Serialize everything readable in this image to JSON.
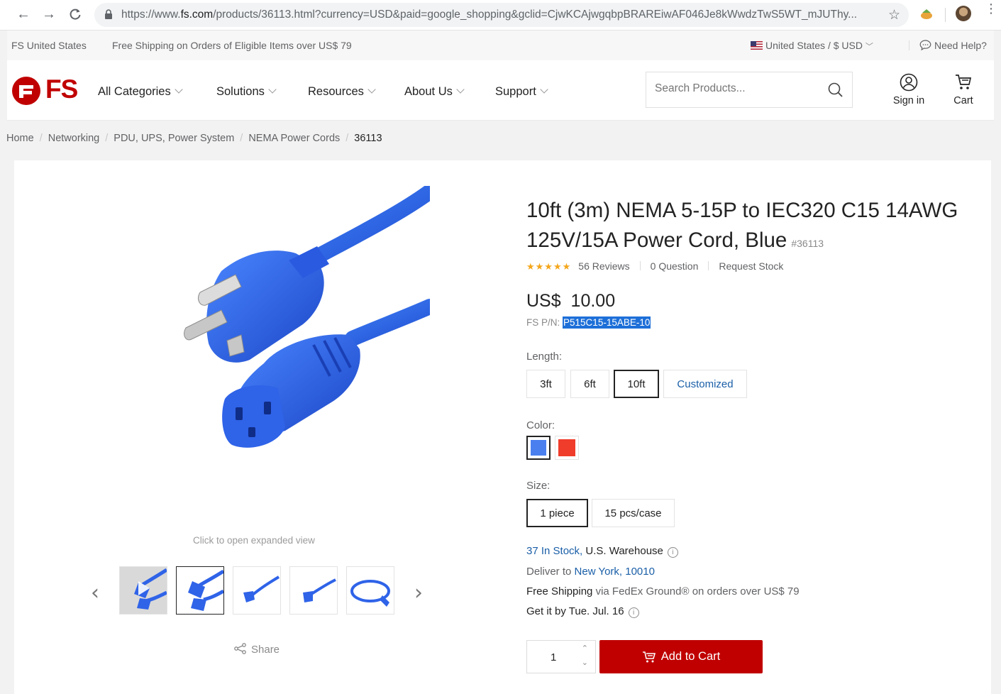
{
  "browser": {
    "url_prefix": "https://www.",
    "url_domain": "fs.com",
    "url_rest": "/products/36113.html?currency=USD&paid=google_shopping&gclid=CjwKCAjwgqbpBRAREiwAF046Je8kWwdzTwS5WT_mJUThy..."
  },
  "topbar": {
    "site_region": "FS United States",
    "shipping_notice": "Free Shipping on Orders of Eligible Items over US$ 79",
    "locale": "United States / $ USD",
    "help": "Need Help?"
  },
  "header": {
    "logo_text": "FS",
    "menu": [
      "All Categories",
      "Solutions",
      "Resources",
      "About Us",
      "Support"
    ],
    "search_placeholder": "Search Products...",
    "sign_in": "Sign in",
    "cart": "Cart"
  },
  "breadcrumb": [
    "Home",
    "Networking",
    "PDU, UPS, Power System",
    "NEMA Power Cords",
    "36113"
  ],
  "gallery": {
    "click_note": "Click to open expanded view",
    "share": "Share"
  },
  "product": {
    "title": "10ft (3m) NEMA 5-15P to IEC320 C15 14AWG 125V/15A Power Cord, Blue",
    "id": "#36113",
    "rating_stars": 5,
    "reviews": "56 Reviews",
    "questions": "0 Question",
    "request_stock": "Request Stock",
    "currency": "US$",
    "price": "10.00",
    "pn_label": "FS P/N:",
    "pn_value": "P515C15-15ABE-10",
    "length_label": "Length:",
    "lengths": [
      "3ft",
      "6ft",
      "10ft",
      "Customized"
    ],
    "color_label": "Color:",
    "colors": [
      "#4a7ff0",
      "#f03c2a"
    ],
    "size_label": "Size:",
    "sizes": [
      "1 piece",
      "15 pcs/case"
    ],
    "stock_count": "37 In Stock,",
    "warehouse": "U.S. Warehouse",
    "deliver_label": "Deliver to",
    "deliver_location": "New York, 10010",
    "free_shipping": "Free Shipping",
    "shipping_detail": "via FedEx Ground® on orders over US$ 79",
    "get_it_by": "Get it by Tue. Jul. 16",
    "quantity": "1",
    "add_to_cart": "Add to Cart"
  }
}
